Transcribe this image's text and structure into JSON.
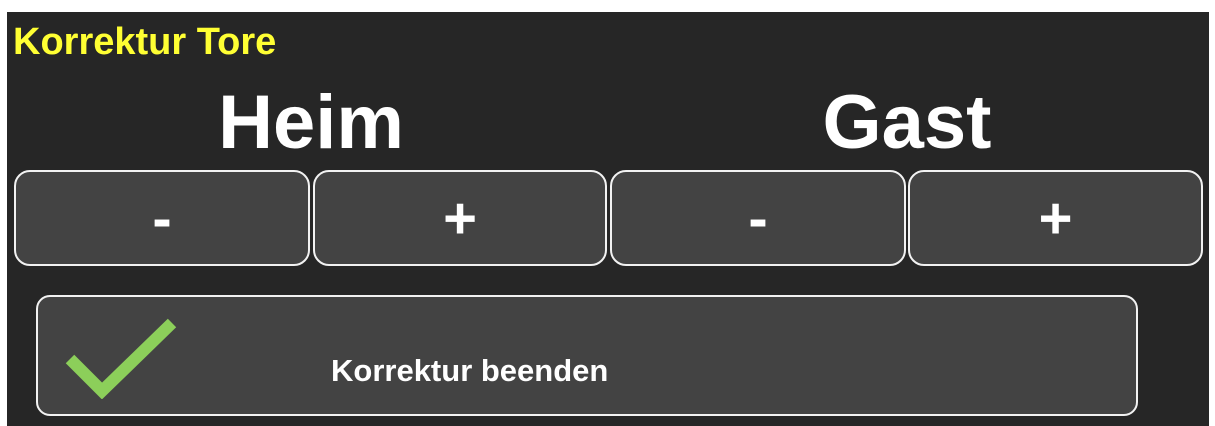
{
  "title": "Korrektur Tore",
  "teams": {
    "home": {
      "label": "Heim",
      "minus_label": "-",
      "plus_label": "+"
    },
    "guest": {
      "label": "Gast",
      "minus_label": "-",
      "plus_label": "+"
    }
  },
  "confirm": {
    "label": "Korrektur beenden",
    "icon": "checkmark-icon"
  },
  "colors": {
    "background": "#262626",
    "title": "#ffff33",
    "button": "#434343",
    "button_border": "#f2f2f2",
    "checkmark": "#8ccf5a",
    "text": "#ffffff"
  }
}
